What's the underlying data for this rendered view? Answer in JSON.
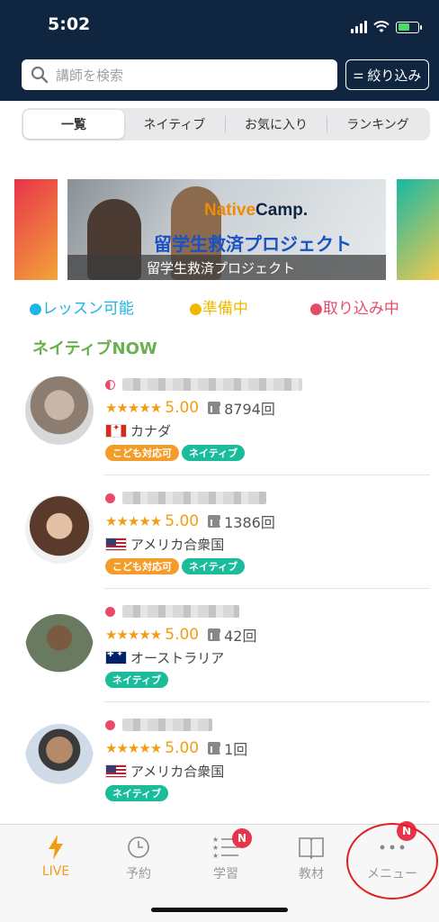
{
  "status_bar": {
    "time": "5:02"
  },
  "search": {
    "placeholder": "講師を検索",
    "filter_label": "絞り込み"
  },
  "segments": [
    {
      "label": "一覧",
      "active": true
    },
    {
      "label": "ネイティブ",
      "active": false
    },
    {
      "label": "お気に入り",
      "active": false
    },
    {
      "label": "ランキング",
      "active": false
    }
  ],
  "banner": {
    "brand_prefix": "Native",
    "brand_suffix": "Camp.",
    "headline": "留学生救済プロジェクト",
    "caption": "留学生救済プロジェクト"
  },
  "legend": [
    {
      "label": "●レッスン可能",
      "color": "#1fb5e8"
    },
    {
      "label": "●準備中",
      "color": "#f0b800"
    },
    {
      "label": "●取り込み中",
      "color": "#e84a6a"
    }
  ],
  "section_title": "ネイティブNOW",
  "teachers": [
    {
      "name": "",
      "status_color": "#e84a6a",
      "stars": "★★★★★",
      "rating": "5.00",
      "lessons": "8794回",
      "flag": "ca",
      "country": "カナダ",
      "tags": [
        "こども対応可",
        "ネイティブ"
      ]
    },
    {
      "name": "",
      "status_color": "#e84a6a",
      "stars": "★★★★★",
      "rating": "5.00",
      "lessons": "1386回",
      "flag": "us",
      "country": "アメリカ合衆国",
      "tags": [
        "こども対応可",
        "ネイティブ"
      ]
    },
    {
      "name": "",
      "status_color": "#e84a6a",
      "stars": "★★★★★",
      "rating": "5.00",
      "lessons": "42回",
      "flag": "au",
      "country": "オーストラリア",
      "tags": [
        "ネイティブ"
      ]
    },
    {
      "name": "",
      "status_color": "#e84a6a",
      "stars": "★★★★★",
      "rating": "5.00",
      "lessons": "1回",
      "flag": "us",
      "country": "アメリカ合衆国",
      "tags": [
        "ネイティブ"
      ]
    }
  ],
  "tabbar": {
    "live": "LIVE",
    "reservation": "予約",
    "study": "学習",
    "study_badge": "N",
    "materials": "教材",
    "menu": "メニュー",
    "menu_badge": "N"
  },
  "colors": {
    "header_bg": "#0f2540",
    "accent": "#f39c12",
    "native_tag": "#1abc9c",
    "kids_tag": "#f39c2a",
    "busy": "#e84a6a"
  }
}
